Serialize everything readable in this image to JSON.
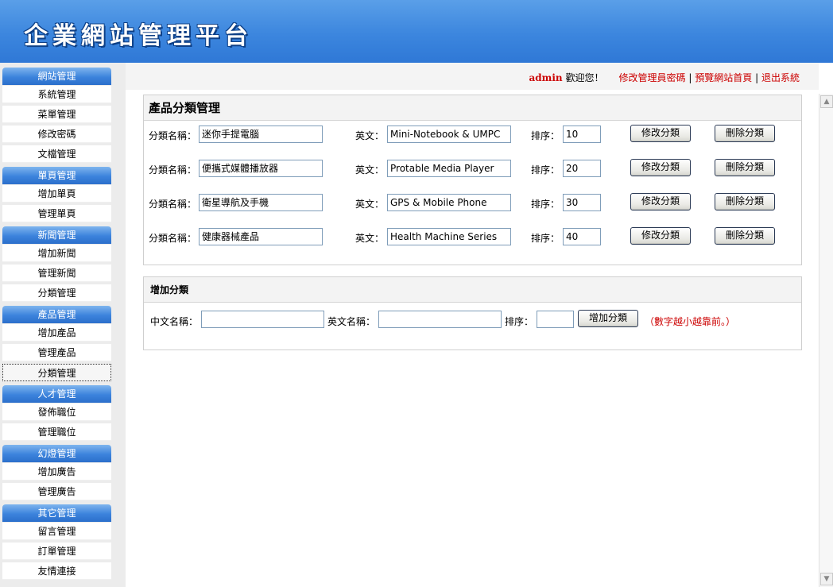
{
  "header": {
    "title": "企業網站管理平台"
  },
  "topbar": {
    "user": "admin",
    "welcome": "歡迎您！",
    "links": [
      "修改管理員密碼",
      "預覽網站首頁",
      "退出系統"
    ],
    "sep": "|"
  },
  "sidebar": {
    "groups": [
      {
        "title": "網站管理",
        "items": [
          "系統管理",
          "菜單管理",
          "修改密碼",
          "文檔管理"
        ]
      },
      {
        "title": "單頁管理",
        "items": [
          "增加單頁",
          "管理單頁"
        ]
      },
      {
        "title": "新聞管理",
        "items": [
          "增加新聞",
          "管理新聞",
          "分類管理"
        ]
      },
      {
        "title": "產品管理",
        "items": [
          "增加產品",
          "管理產品",
          "分類管理"
        ]
      },
      {
        "title": "人才管理",
        "items": [
          "發佈職位",
          "管理職位"
        ]
      },
      {
        "title": "幻燈管理",
        "items": [
          "增加廣告",
          "管理廣告"
        ]
      },
      {
        "title": "其它管理",
        "items": [
          "留言管理",
          "訂單管理",
          "友情連接"
        ]
      }
    ]
  },
  "category_panel": {
    "title": "產品分類管理",
    "name_label": "分類名稱：",
    "en_label": "英文：",
    "order_label": "排序：",
    "edit_button": "修改分類",
    "delete_button": "刪除分類",
    "rows": [
      {
        "name": "迷你手提電腦",
        "en": "Mini-Notebook & UMPC",
        "order": "10"
      },
      {
        "name": "便攜式媒體播放器",
        "en": "Protable Media Player",
        "order": "20"
      },
      {
        "name": "衛星導航及手機",
        "en": "GPS & Mobile Phone",
        "order": "30"
      },
      {
        "name": "健康器械產品",
        "en": "Health Machine Series",
        "order": "40"
      }
    ]
  },
  "add_panel": {
    "title": "增加分類",
    "cn_label": "中文名稱：",
    "en_label": "英文名稱：",
    "order_label": "排序：",
    "button": "增加分類",
    "hint": "（數字越小越靠前。）"
  },
  "colors": {
    "accent": "#3c86de",
    "link": "#cc0000"
  }
}
